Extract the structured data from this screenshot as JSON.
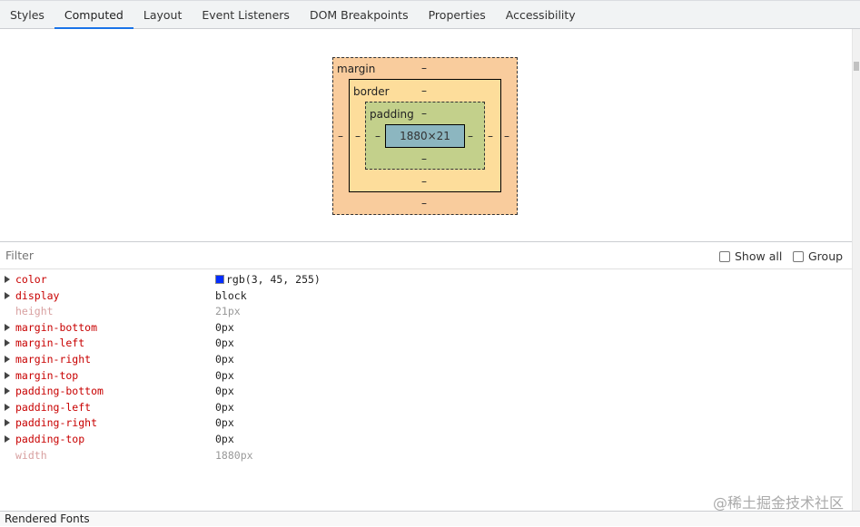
{
  "tabs": [
    "Styles",
    "Computed",
    "Layout",
    "Event Listeners",
    "DOM Breakpoints",
    "Properties",
    "Accessibility"
  ],
  "active_tab": "Computed",
  "box_model": {
    "margin_label": "margin",
    "border_label": "border",
    "padding_label": "padding",
    "content": "1880×21",
    "dash": "–",
    "colors": {
      "margin": "#f9cc9d",
      "border": "#fddd9b",
      "padding": "#c3d08b",
      "content": "#8cb6c0"
    }
  },
  "filter": {
    "placeholder": "Filter",
    "show_all": "Show all",
    "group": "Group"
  },
  "properties": [
    {
      "name": "color",
      "value": "rgb(3, 45, 255)",
      "swatch": "#032dff",
      "expandable": true
    },
    {
      "name": "display",
      "value": "block",
      "expandable": true
    },
    {
      "name": "height",
      "value": "21px",
      "expandable": false
    },
    {
      "name": "margin-bottom",
      "value": "0px",
      "expandable": true
    },
    {
      "name": "margin-left",
      "value": "0px",
      "expandable": true
    },
    {
      "name": "margin-right",
      "value": "0px",
      "expandable": true
    },
    {
      "name": "margin-top",
      "value": "0px",
      "expandable": true
    },
    {
      "name": "padding-bottom",
      "value": "0px",
      "expandable": true
    },
    {
      "name": "padding-left",
      "value": "0px",
      "expandable": true
    },
    {
      "name": "padding-right",
      "value": "0px",
      "expandable": true
    },
    {
      "name": "padding-top",
      "value": "0px",
      "expandable": true
    },
    {
      "name": "width",
      "value": "1880px",
      "expandable": false
    }
  ],
  "watermark": "@稀土掘金技术社区",
  "footer": "Rendered Fonts"
}
